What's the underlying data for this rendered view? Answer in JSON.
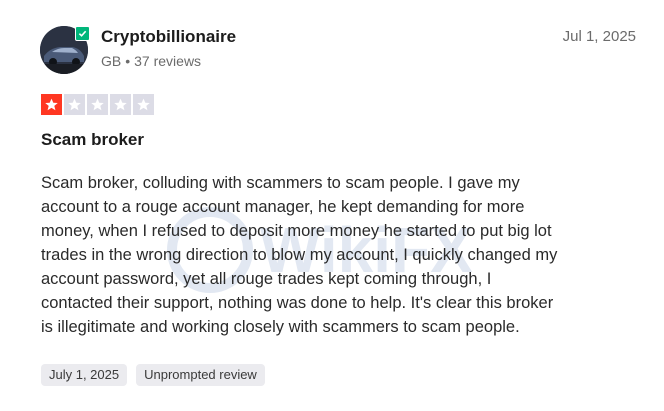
{
  "review": {
    "reviewer_name": "Cryptobillionaire",
    "country": "GB",
    "separator": "•",
    "review_count": "37 reviews",
    "date": "Jul 1, 2025",
    "rating": 1,
    "rating_max": 5,
    "title": "Scam broker",
    "body": "Scam broker, colluding with scammers to scam people. I gave my\naccount to a rouge account manager, he kept demanding for more\nmoney, when I refused to deposit more money he started to put big lot\ntrades in the wrong direction to blow my account, I quickly changed my\naccount password, yet all rouge trades kept coming through, I\ncontacted their support, nothing was done to help. It's clear this broker\nis illegitimate and working closely with scammers to scam people.",
    "tags": [
      "July 1, 2025",
      "Unprompted review"
    ]
  },
  "colors": {
    "star_filled": "#ff3722",
    "star_empty": "#dcdce6",
    "verified": "#00b67a",
    "tag_bg": "#ebebef"
  },
  "watermark": {
    "text": "WikiFX"
  }
}
